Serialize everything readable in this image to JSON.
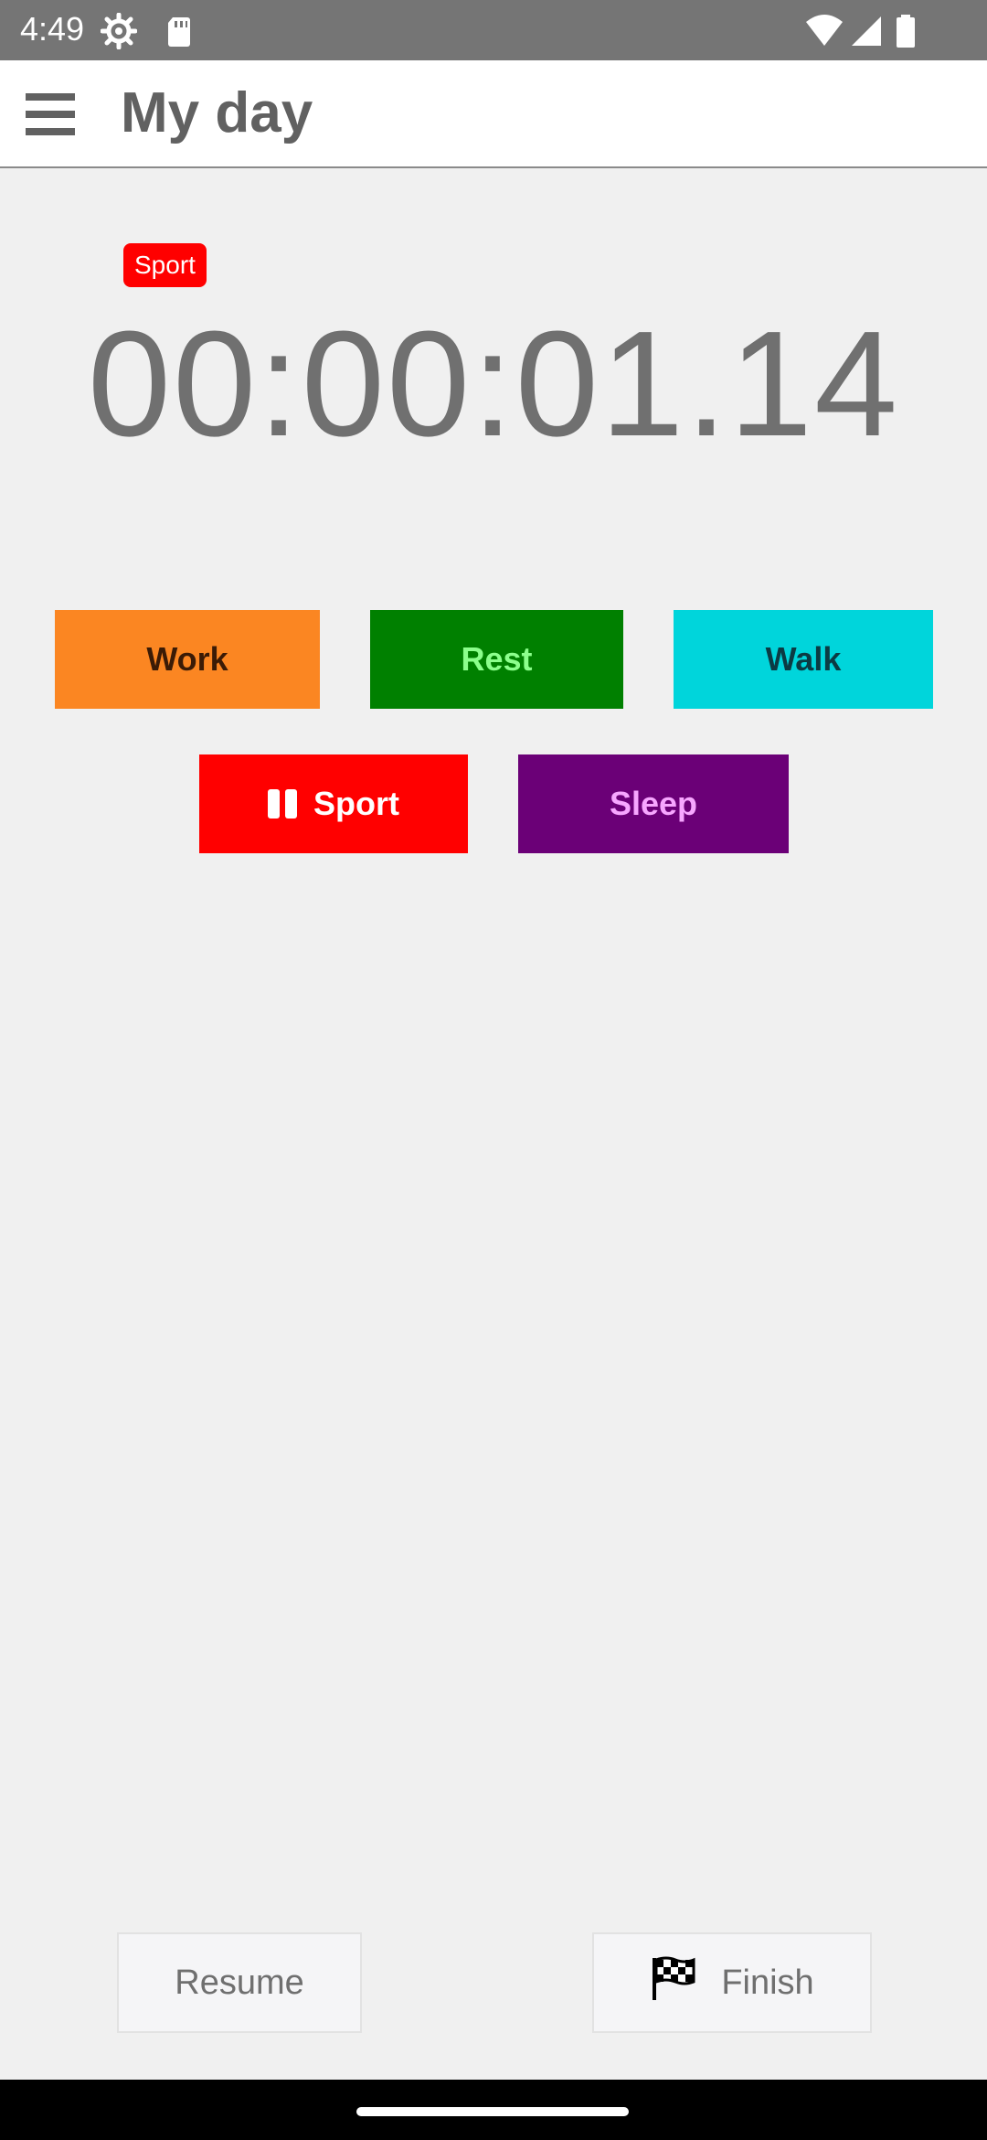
{
  "status_bar": {
    "time": "4:49",
    "icons": [
      "settings-gear-icon",
      "sd-card-icon",
      "wifi-icon",
      "cell-signal-icon",
      "battery-icon"
    ]
  },
  "app_bar": {
    "title": "My day",
    "menu_icon": "hamburger-menu-icon"
  },
  "timer": {
    "active_activity": "Sport",
    "elapsed": "00:00:01.14"
  },
  "activities": [
    {
      "label": "Work",
      "color": "#fb8622",
      "text_color": "#3b1b06",
      "active": false
    },
    {
      "label": "Rest",
      "color": "#008000",
      "text_color": "#8cff8c",
      "active": false
    },
    {
      "label": "Walk",
      "color": "#00d5db",
      "text_color": "#0b3b43",
      "active": false
    },
    {
      "label": "Sport",
      "color": "#ff0000",
      "text_color": "#ffffff",
      "active": true,
      "icon": "pause-icon"
    },
    {
      "label": "Sleep",
      "color": "#6b0077",
      "text_color": "#f7a6ff",
      "active": false
    }
  ],
  "actions": {
    "resume_label": "Resume",
    "finish_label": "Finish",
    "finish_icon": "checkered-flag-icon"
  },
  "colors": {
    "status_bar": "#757575",
    "background": "#f0f0f0",
    "badge": "#ff0000"
  }
}
